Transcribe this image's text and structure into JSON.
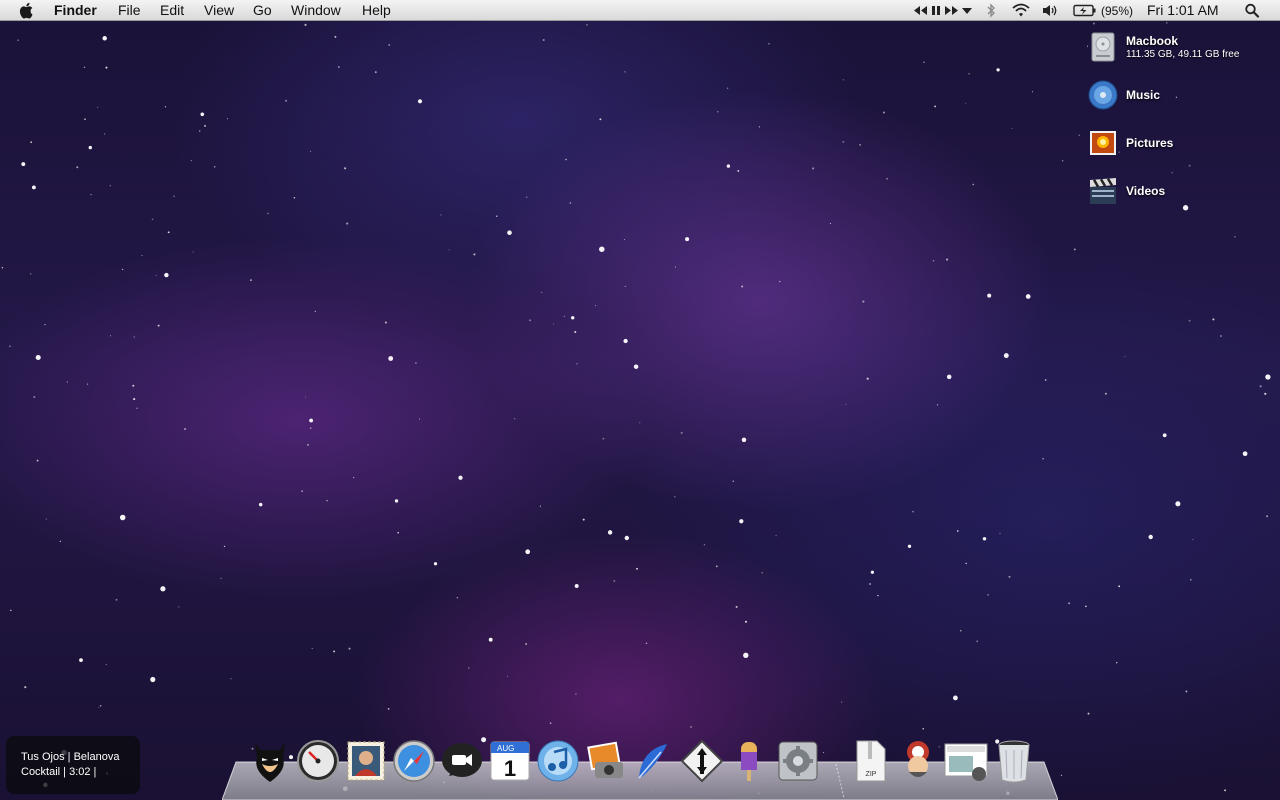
{
  "menubar": {
    "app_name": "Finder",
    "menus": [
      "File",
      "Edit",
      "View",
      "Go",
      "Window",
      "Help"
    ],
    "battery_text": "(95%)",
    "clock": "Fri 1:01 AM",
    "icons": [
      "apple-logo",
      "rewind",
      "play-pause",
      "fast-forward",
      "media-menu",
      "bluetooth",
      "wifi",
      "volume",
      "battery",
      "spotlight-search"
    ]
  },
  "desktop_icons": [
    {
      "label": "Macbook",
      "detail": "111.35 GB, 49.11 GB free",
      "icon": "hard-drive-icon"
    },
    {
      "label": "Music",
      "detail": "",
      "icon": "music-disc-icon"
    },
    {
      "label": "Pictures",
      "detail": "",
      "icon": "pictures-icon"
    },
    {
      "label": "Videos",
      "detail": "",
      "icon": "clapperboard-icon"
    }
  ],
  "now_playing": {
    "line1": "Tus Ojos | Belanova",
    "line2": "Cocktail | 3:02 |"
  },
  "dock": {
    "apps": [
      "finder-batman",
      "dashboard",
      "mail-stamp",
      "safari",
      "facetime",
      "calendar",
      "itunes",
      "iphoto",
      "feather-writer",
      "transmit",
      "ice-pop",
      "system-preferences"
    ],
    "stacks": [
      "archive-zip",
      "chef",
      "photo-browser",
      "trash"
    ],
    "calendar_month": "AUG",
    "calendar_day": "1",
    "zip_label": "ZIP"
  },
  "colors": {
    "menubar": "#e6e6e6",
    "sky_dark": "#1a1238",
    "nebula_purple": "#7a3caa",
    "nebula_blue": "#2a2a78"
  }
}
